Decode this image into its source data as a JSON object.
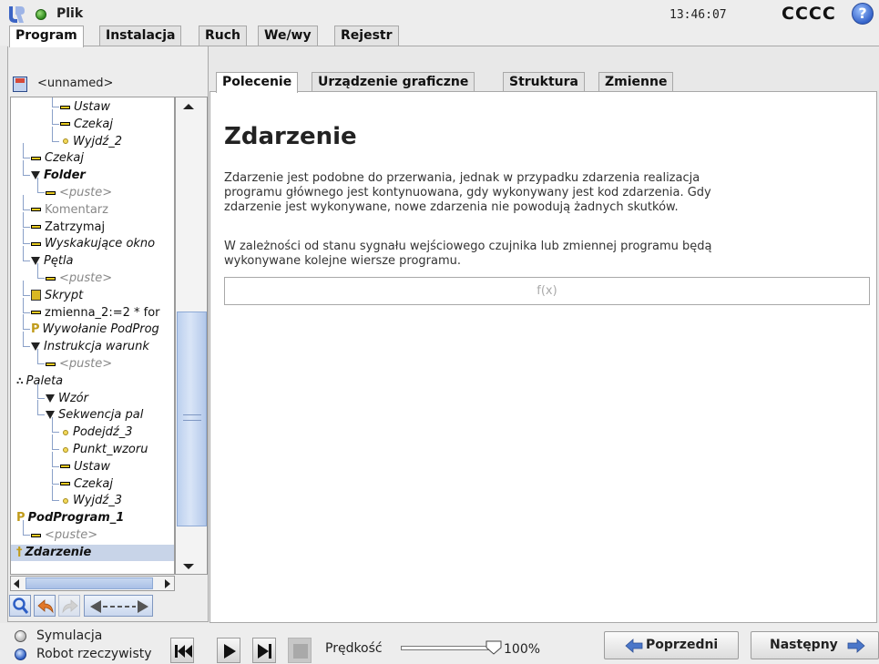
{
  "header": {
    "file_label": "Plik",
    "time": "13:46:07",
    "robot_name": "CCCC",
    "help_symbol": "?"
  },
  "main_tabs": [
    "Program",
    "Instalacja",
    "Ruch",
    "We/wy",
    "Rejestr"
  ],
  "active_main_tab": "Program",
  "program": {
    "name": "<unnamed>"
  },
  "tree": [
    {
      "label": "Ustaw",
      "icon": "dash-icon",
      "style": "italic",
      "level": 3
    },
    {
      "label": "Czekaj",
      "icon": "dash-icon",
      "style": "italic",
      "level": 3
    },
    {
      "label": "Wyjdź_2",
      "icon": "waypoint-icon",
      "style": "italic",
      "level": 3
    },
    {
      "label": "Czekaj",
      "icon": "dash-icon",
      "style": "italic",
      "level": 1
    },
    {
      "label": "Folder",
      "icon": "folder-triangle-icon",
      "style": "bold-italic",
      "level": 1
    },
    {
      "label": "<puste>",
      "icon": "dash-icon",
      "style": "gray-italic",
      "level": 2
    },
    {
      "label": "Komentarz",
      "icon": "dash-icon",
      "style": "gray",
      "level": 1
    },
    {
      "label": "Zatrzymaj",
      "icon": "dash-icon",
      "style": "normal",
      "level": 1
    },
    {
      "label": "Wyskakujące okno",
      "icon": "dash-icon",
      "style": "italic",
      "level": 1
    },
    {
      "label": "Pętla",
      "icon": "loop-triangle-icon",
      "style": "italic",
      "level": 1
    },
    {
      "label": "<puste>",
      "icon": "dash-icon",
      "style": "gray-italic",
      "level": 2
    },
    {
      "label": "Skrypt",
      "icon": "script-icon",
      "style": "italic",
      "level": 1
    },
    {
      "label": "zmienna_2:=2 * for",
      "icon": "dash-icon",
      "style": "normal",
      "level": 1
    },
    {
      "label": "Wywołanie PodProg",
      "icon": "subprogram-icon",
      "style": "italic",
      "level": 1
    },
    {
      "label": "Instrukcja warunk",
      "icon": "if-triangle-icon",
      "style": "italic",
      "level": 1
    },
    {
      "label": "<puste>",
      "icon": "dash-icon",
      "style": "gray-italic",
      "level": 2
    },
    {
      "label": "Paleta",
      "icon": "pallet-icon",
      "style": "italic",
      "level": 0
    },
    {
      "label": "Wzór",
      "icon": "pattern-triangle-icon",
      "style": "italic",
      "level": 2
    },
    {
      "label": "Sekwencja pal",
      "icon": "sequence-triangle-icon",
      "style": "italic",
      "level": 2
    },
    {
      "label": "Podejdź_3",
      "icon": "waypoint-icon",
      "style": "italic",
      "level": 3
    },
    {
      "label": "Punkt_wzoru",
      "icon": "waypoint-icon",
      "style": "italic",
      "level": 3
    },
    {
      "label": "Ustaw",
      "icon": "dash-icon",
      "style": "italic",
      "level": 3
    },
    {
      "label": "Czekaj",
      "icon": "dash-icon",
      "style": "italic",
      "level": 3
    },
    {
      "label": "Wyjdź_3",
      "icon": "waypoint-icon",
      "style": "italic",
      "level": 3
    },
    {
      "label": "PodProgram_1",
      "icon": "subprogram-icon",
      "style": "bold-italic",
      "level": 0
    },
    {
      "label": "<puste>",
      "icon": "dash-icon",
      "style": "gray-italic",
      "level": 1
    },
    {
      "label": "Zdarzenie",
      "icon": "event-icon",
      "style": "bold-italic-selected",
      "level": 0
    }
  ],
  "sub_tabs": [
    "Polecenie",
    "Urządzenie graficzne",
    "Struktura",
    "Zmienne"
  ],
  "active_sub_tab": "Polecenie",
  "content": {
    "title": "Zdarzenie",
    "para1": [
      "Zdarzenie jest podobne do przerwania, jednak w przypadku zdarzenia realizacja",
      "programu głównego jest kontynuowana, gdy wykonywany jest kod zdarzenia. Gdy",
      "zdarzenie jest wykonywane, nowe zdarzenia nie powodują żadnych skutków."
    ],
    "para2": [
      "W zależności od stanu sygnału wejściowego czujnika lub zmiennej programu będą",
      "wykonywane kolejne wiersze programu."
    ],
    "expression_placeholder": "f(x)"
  },
  "footer": {
    "mode_simulation": "Symulacja",
    "mode_real": "Robot rzeczywisty",
    "selected_mode": "Robot rzeczywisty",
    "speed_label": "Prędkość",
    "speed_value": "100%",
    "speed_fraction": 1.0,
    "prev_label": "Poprzedni",
    "next_label": "Następny"
  },
  "colors": {
    "selection": "#c8d4e8",
    "accent_blue": "#2b5cc2",
    "nav_arrow": "#4a76c9"
  }
}
